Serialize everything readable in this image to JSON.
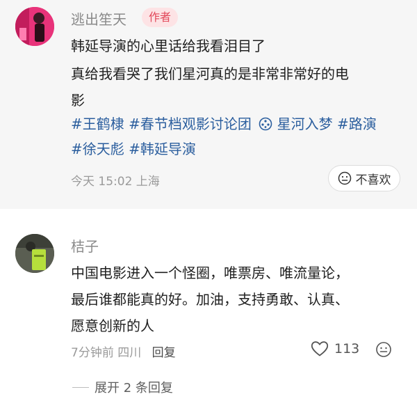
{
  "post": {
    "username": "逃出笙天",
    "author_tag": "作者",
    "line1": "韩延导演的心里话给我看泪目了",
    "line2": "真给我看哭了我们星河真的是非常非常好的电",
    "line3": "影",
    "hashtags1": "#王鹤棣 #春节档观影讨论团",
    "topic_link": "星河入梦",
    "hashtags1b": "#路演",
    "hashtags2": "#徐天彪 #韩延导演",
    "meta": "今天 15:02 上海",
    "dislike_label": "不喜欢",
    "link_icon": "film-reel-icon",
    "dislike_icon": "sad-face-icon"
  },
  "comment": {
    "username": "桔子",
    "line1": "中国电影进入一个怪圈，唯票房、唯流量论，",
    "line2": "最后谁都能真的好。加油，支持勇敢、认真、",
    "line3": "愿意创新的人",
    "meta": "7分钟前 四川",
    "reply_label": "回复",
    "like_count": "113",
    "like_icon": "heart-icon",
    "more_icon": "emoji-face-icon",
    "expand_label": "展开 2 条回复"
  }
}
